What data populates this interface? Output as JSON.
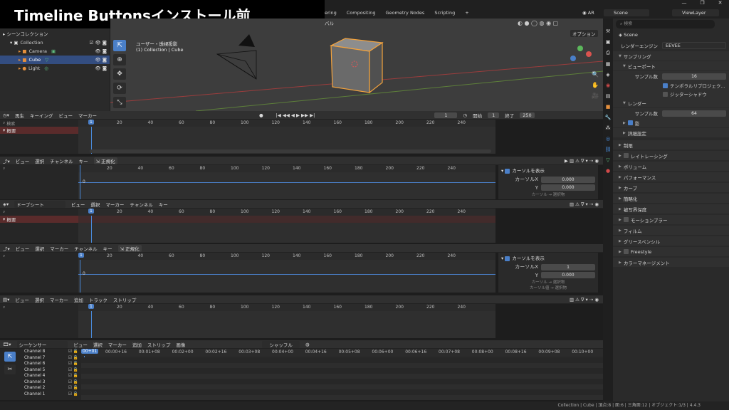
{
  "title": "Timeline Buttonsインストール前",
  "topbar": {
    "tabs": [
      "ering",
      "Compositing",
      "Geometry Nodes",
      "Scripting"
    ],
    "add": "+",
    "ar": "AR",
    "scene": "Scene",
    "viewlayer": "ViewLayer",
    "options": "オプション"
  },
  "outliner": {
    "title": "シーンコレクション",
    "items": [
      {
        "label": "Collection",
        "indent": 1,
        "color": "#cfcfcf"
      },
      {
        "label": "Camera",
        "indent": 2,
        "color": "#cfcfcf"
      },
      {
        "label": "Cube",
        "indent": 2,
        "color": "#ffffff",
        "selected": true
      },
      {
        "label": "Light",
        "indent": 2,
        "color": "#cfcfcf"
      }
    ]
  },
  "viewport": {
    "label1": "ユーザー・透視投影",
    "label2": "(1) Collection | Cube",
    "mode_text": "バル"
  },
  "timeline1": {
    "menus": [
      "再生",
      "キーイング",
      "ビュー",
      "マーカー"
    ],
    "frame": "1",
    "start_label": "開始",
    "start": "1",
    "end_label": "終了",
    "end": "250",
    "search": "検索",
    "summary": "概要",
    "ticks": [
      "20",
      "40",
      "60",
      "80",
      "100",
      "120",
      "140",
      "160",
      "180",
      "200",
      "220",
      "240"
    ]
  },
  "graph1": {
    "menus": [
      "ビュー",
      "選択",
      "チャンネル",
      "キー"
    ],
    "normalize": "正規化",
    "ticks": [
      "20",
      "40",
      "60",
      "80",
      "100",
      "120",
      "140",
      "160",
      "180",
      "200",
      "220",
      "240"
    ],
    "zero": "0",
    "cursor_panel": {
      "title": "カーソルを表示",
      "x_label": "カーソルX",
      "x": "0.000",
      "y_label": "Y",
      "y": "0.000",
      "foot": "カーソル → 選択物"
    }
  },
  "dopesheet": {
    "mode": "ドープシート",
    "menus": [
      "ビュー",
      "選択",
      "マーカー",
      "チャンネル",
      "キー"
    ],
    "summary": "概要",
    "ticks": [
      "20",
      "40",
      "60",
      "80",
      "100",
      "120",
      "140",
      "160",
      "180",
      "200",
      "220",
      "240"
    ]
  },
  "graph2": {
    "menus": [
      "ビュー",
      "選択",
      "マーカー",
      "チャンネル",
      "キー"
    ],
    "normalize": "正規化",
    "ticks": [
      "20",
      "40",
      "60",
      "80",
      "100",
      "120",
      "140",
      "160",
      "180",
      "200",
      "220",
      "240"
    ],
    "zero": "0",
    "cursor_panel": {
      "title": "カーソルを表示",
      "x_label": "カーソルX",
      "x": "1",
      "y_label": "Y",
      "y": "0.000",
      "foot1": "カーソル → 選択物",
      "foot2": "カーソル値 → 選択物"
    }
  },
  "nla": {
    "menus": [
      "ビュー",
      "選択",
      "マーカー",
      "追加",
      "トラック",
      "ストリップ"
    ],
    "ticks": [
      "20",
      "40",
      "60",
      "80",
      "100",
      "120",
      "140",
      "160",
      "180",
      "200",
      "220",
      "240"
    ]
  },
  "sequencer": {
    "mode": "シーケンサー",
    "menus": [
      "ビュー",
      "選択",
      "マーカー",
      "追加",
      "ストリップ",
      "画像"
    ],
    "snap": "シャッフル",
    "time": "00+01",
    "ticks": [
      "00:00+16",
      "00:01+08",
      "00:02+00",
      "00:02+16",
      "00:03+08",
      "00:04+00",
      "00:04+16",
      "00:05+08",
      "00:06+00",
      "00:06+16",
      "00:07+08",
      "00:08+00",
      "00:08+16",
      "00:09+08",
      "00:10+00"
    ],
    "channels": [
      "Channel 8",
      "Channel 7",
      "Channel 6",
      "Channel 5",
      "Channel 4",
      "Channel 3",
      "Channel 2",
      "Channel 1"
    ]
  },
  "properties": {
    "search": "検索",
    "scene": "Scene",
    "engine_label": "レンダーエンジン",
    "engine": "EEVEE",
    "sampling": "サンプリング",
    "viewport": "ビューポート",
    "samples_label": "サンプル数",
    "viewport_samples": "16",
    "temporal": "テンポラルリプロジェク...",
    "jitter": "ジッターシャドウ",
    "render": "レンダー",
    "render_samples": "64",
    "shadows": "影",
    "advanced": "詳細設定",
    "sections": [
      "制限",
      "レイトレーシング",
      "ボリューム",
      "パフォーマンス",
      "カーブ",
      "簡略化",
      "被写界深度",
      "モーションブラー",
      "フィルム",
      "グリースペンシル",
      "Freestyle",
      "カラーマネージメント"
    ]
  },
  "statusbar": "Collection | Cube | 頂点:8 | 面:6 | 三角面:12 | オブジェクト:1/3 | 4.4.3",
  "colors": {
    "accent": "#4a7fc8",
    "selection": "#f4a33d",
    "cursor": "#4a8bdd"
  }
}
